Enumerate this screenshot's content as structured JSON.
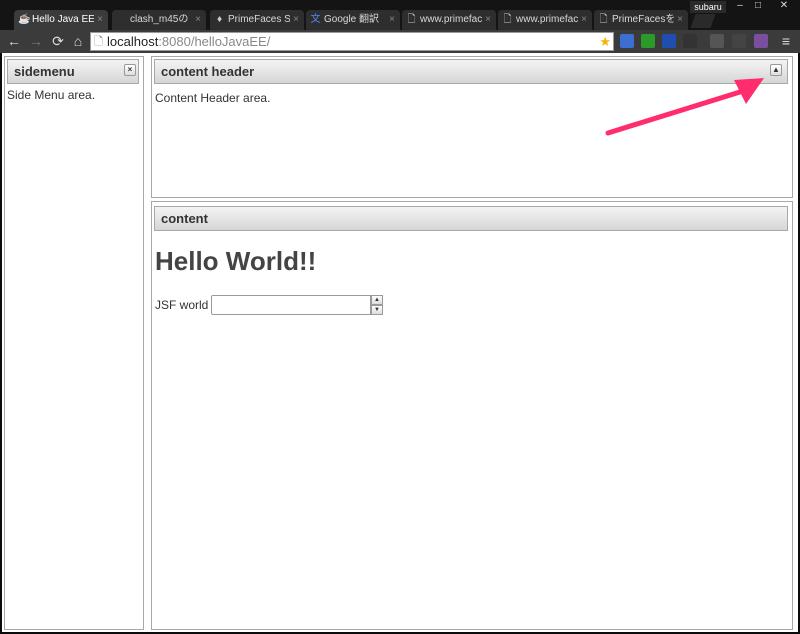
{
  "browser": {
    "profile": "subaru",
    "window_controls": {
      "minimize": "–",
      "maximize": "□",
      "close": "✕"
    },
    "tabs": [
      {
        "label": "Hello Java EE",
        "active": true
      },
      {
        "label": "clash_m45の",
        "active": false
      },
      {
        "label": "PrimeFaces SI",
        "active": false
      },
      {
        "label": "Google 翻訳",
        "active": false
      },
      {
        "label": "www.primefac",
        "active": false
      },
      {
        "label": "www.primefac",
        "active": false
      },
      {
        "label": "PrimeFacesを",
        "active": false
      }
    ],
    "address": {
      "host": "localhost",
      "rest": ":8080/helloJavaEE/"
    },
    "icons": {
      "back": "←",
      "forward": "→",
      "reload": "⟳",
      "home": "⌂",
      "star": "★",
      "menu": "≡",
      "page": "🗋",
      "close": "×"
    }
  },
  "page": {
    "west": {
      "title": "sidemenu",
      "body": "Side Menu area.",
      "close_icon": "×"
    },
    "north": {
      "title": "content header",
      "body": "Content Header area.",
      "collapse_icon": "▲"
    },
    "center": {
      "title": "content",
      "heading": "Hello World!!",
      "field_label": "JSF world",
      "field_value": "",
      "spin_up": "▲",
      "spin_down": "▼"
    }
  },
  "colors": {
    "annotation_arrow": "#ff2d6e",
    "chrome_dark": "#141414",
    "toolbar": "#3b3b3b"
  }
}
